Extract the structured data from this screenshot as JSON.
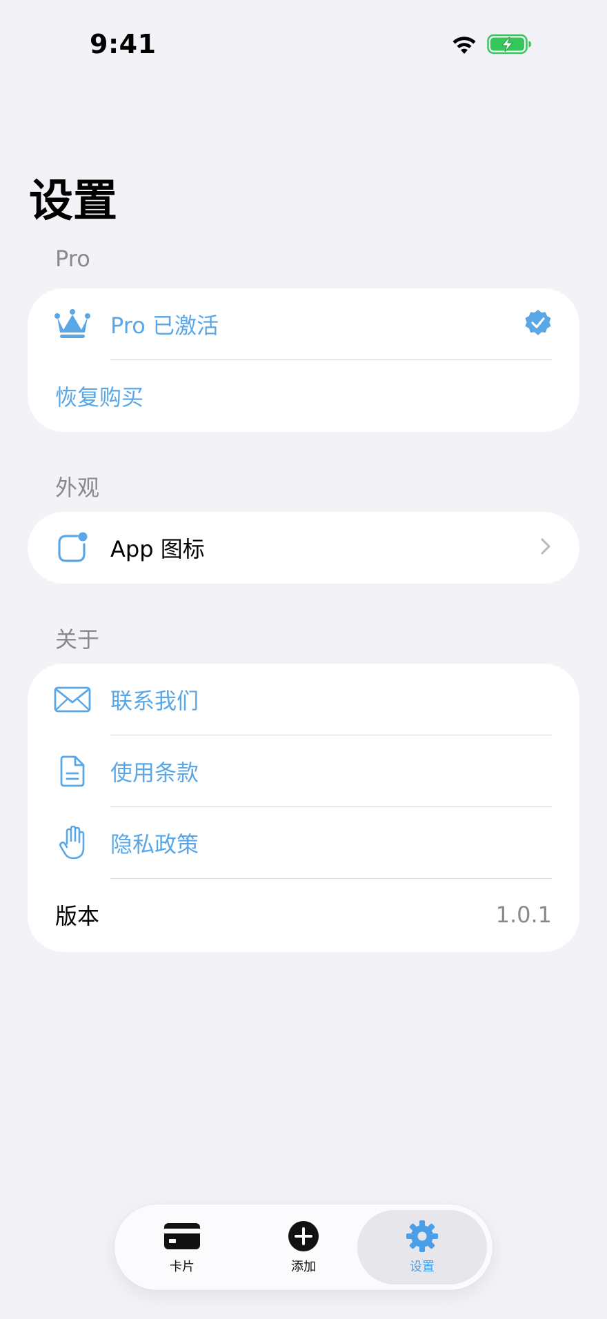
{
  "status_bar": {
    "time": "9:41"
  },
  "page": {
    "title": "设置"
  },
  "sections": {
    "pro": {
      "header": "Pro",
      "items": [
        {
          "label": "Pro 已激活",
          "icon": "crown-icon",
          "trailing": "verified-badge-icon"
        },
        {
          "label": "恢复购买"
        }
      ]
    },
    "appearance": {
      "header": "外观",
      "items": [
        {
          "label": "App 图标",
          "icon": "app-icon-badge-icon",
          "trailing": "chevron-right-icon"
        }
      ]
    },
    "about": {
      "header": "关于",
      "items": [
        {
          "label": "联系我们",
          "icon": "envelope-icon"
        },
        {
          "label": "使用条款",
          "icon": "document-icon"
        },
        {
          "label": "隐私政策",
          "icon": "hand-raised-icon"
        },
        {
          "label": "版本",
          "value": "1.0.1"
        }
      ]
    }
  },
  "tab_bar": {
    "tabs": [
      {
        "label": "卡片",
        "icon": "card-icon"
      },
      {
        "label": "添加",
        "icon": "plus-circle-icon"
      },
      {
        "label": "设置",
        "icon": "gear-icon",
        "active": true
      }
    ]
  },
  "colors": {
    "accent": "#5AA7E8",
    "background": "#F2F2F7",
    "card": "#FFFFFF",
    "secondary_text": "#8A8A8E",
    "battery_green": "#34C759"
  }
}
